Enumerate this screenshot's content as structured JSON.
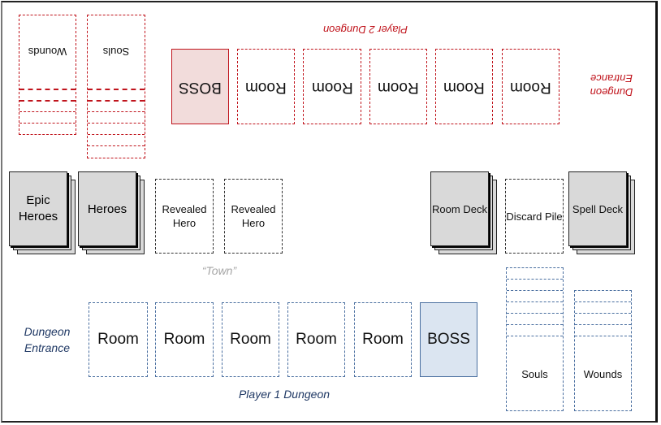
{
  "player2": {
    "label": "Player 2 Dungeon",
    "entrance_label": "Dungeon Entrance",
    "boss": "BOSS",
    "rooms": [
      "Room",
      "Room",
      "Room",
      "Room",
      "Room"
    ],
    "wounds": "Wounds",
    "souls": "Souls",
    "color": "#c0141c"
  },
  "town": {
    "label": "“Town”",
    "epic_heroes": "Epic Heroes",
    "heroes": "Heroes",
    "revealed": [
      "Revealed Hero",
      "Revealed Hero"
    ],
    "room_deck": "Room Deck",
    "discard": "Discard Pile",
    "spell_deck": "Spell Deck"
  },
  "player1": {
    "label": "Player 1 Dungeon",
    "entrance_label": "Dungeon Entrance",
    "rooms": [
      "Room",
      "Room",
      "Room",
      "Room",
      "Room"
    ],
    "boss": "BOSS",
    "souls": "Souls",
    "wounds": "Wounds",
    "color": "#1f3864"
  }
}
